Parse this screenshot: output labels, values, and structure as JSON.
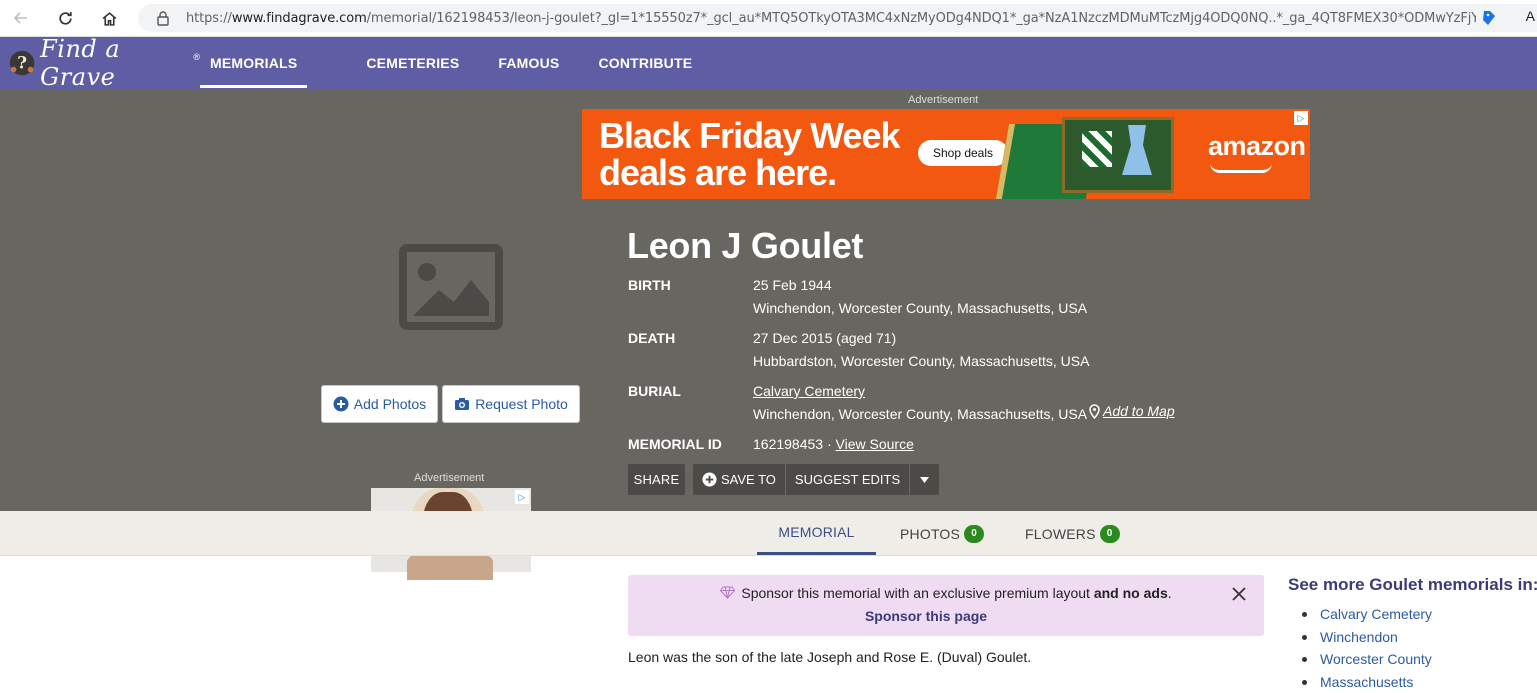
{
  "browser": {
    "url_prefix": "https://",
    "url_domain": "www.findagrave.com",
    "url_rest": "/memorial/162198453/leon-j-goulet?_gl=1*15550z7*_gcl_au*MTQ5OTkyOTA3MC4xNzMyODg4NDQ1*_ga*NzA1NzczMDMuMTczMjg4ODQ0NQ..*_ga_4QT8FMEX30*ODMwYzFjYT...",
    "profile_initial": "A"
  },
  "header": {
    "logo_text": "Find a Grave",
    "logo_mark": "®",
    "nav": [
      "MEMORIALS",
      "CEMETERIES",
      "FAMOUS",
      "CONTRIBUTE"
    ]
  },
  "top_ad": {
    "label": "Advertisement",
    "headline_1": "Black Friday Week",
    "headline_2": "deals are here.",
    "cta": "Shop deals",
    "brand": "amazon"
  },
  "photo": {
    "add_label": "Add Photos",
    "request_label": "Request Photo"
  },
  "memorial": {
    "name": "Leon J Goulet",
    "birth_label": "BIRTH",
    "birth_date": "25 Feb 1944",
    "birth_place": "Winchendon, Worcester County, Massachusetts, USA",
    "death_label": "DEATH",
    "death_date": "27 Dec 2015 (aged 71)",
    "death_place": "Hubbardston, Worcester County, Massachusetts, USA",
    "burial_label": "BURIAL",
    "cemetery": "Calvary Cemetery",
    "burial_place": "Winchendon, Worcester County, Massachusetts, USA",
    "add_to_map": "Add to Map",
    "id_label": "MEMORIAL ID",
    "id_value": "162198453 ·",
    "view_source": "View Source"
  },
  "actions": {
    "share": "SHARE",
    "save_to": "SAVE TO",
    "suggest_edits": "SUGGEST EDITS"
  },
  "side_ad": {
    "label": "Advertisement"
  },
  "tabs": {
    "memorial": "MEMORIAL",
    "photos": "PHOTOS",
    "photos_count": "0",
    "flowers": "FLOWERS",
    "flowers_count": "0"
  },
  "sponsor": {
    "text": "Sponsor this memorial with an exclusive premium layout",
    "and": "and no ads",
    "period": ".",
    "link": "Sponsor this page"
  },
  "bio": "Leon was the son of the late Joseph and Rose E. (Duval) Goulet.",
  "see_more": {
    "prefix": "See more",
    "surname": "Goulet",
    "suffix": "memorials in:",
    "items": [
      "Calvary Cemetery",
      "Winchendon",
      "Worcester County",
      "Massachusetts"
    ]
  }
}
